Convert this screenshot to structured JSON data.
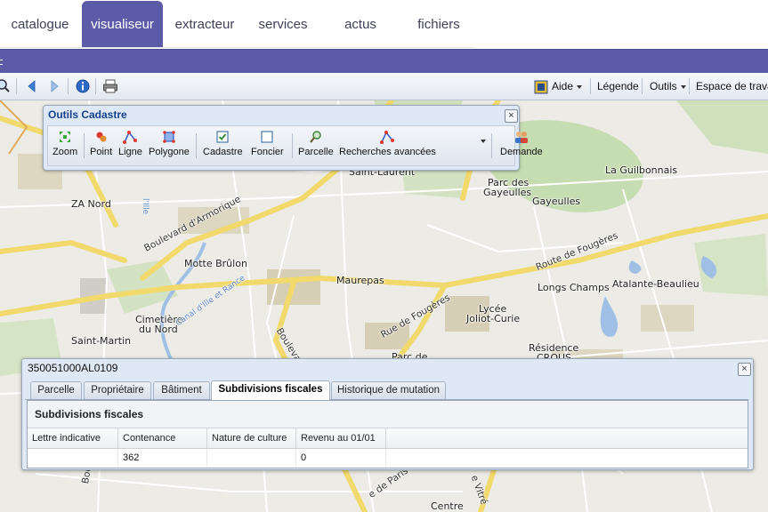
{
  "nav": {
    "tabs": [
      {
        "label": "catalogue"
      },
      {
        "label": "visualiseur"
      },
      {
        "label": "extracteur"
      },
      {
        "label": "services"
      },
      {
        "label": "actus"
      },
      {
        "label": "fichiers"
      }
    ],
    "active_index": 1
  },
  "toolbar": {
    "help_label": "Aide",
    "legend_label": "Légende",
    "tools_label": "Outils",
    "workspace_label": "Espace de travail"
  },
  "outils_cadastre": {
    "title": "Outils Cadastre",
    "tools": [
      {
        "label": "Zoom",
        "icon": "zoom-extent-icon"
      },
      {
        "label": "Point",
        "icon": "point-icon"
      },
      {
        "label": "Ligne",
        "icon": "line-icon"
      },
      {
        "label": "Polygone",
        "icon": "polygon-icon"
      },
      {
        "label": "Cadastre",
        "icon": "checkbox-icon"
      },
      {
        "label": "Foncier",
        "icon": "checkbox-empty-icon"
      },
      {
        "label": "Parcelle",
        "icon": "search-parcel-icon"
      },
      {
        "label": "Recherches avancées",
        "icon": "advanced-search-icon"
      },
      {
        "label": "Demande",
        "icon": "users-icon"
      }
    ]
  },
  "map": {
    "labels": {
      "saint_laurent": "Saint-Laurent",
      "la_guilbonnais": "La Guilbonnais",
      "parc_des_gayeulles_1": "Parc des",
      "parc_des_gayeulles_2": "Gayeulles",
      "gayeulles": "Gayeulles",
      "za_nord": "ZA Nord",
      "bd_armorique": "Boulevard d'Armorique",
      "motte_brulon": "Motte Brûlon",
      "route_fougeres": "Route de Fougères",
      "maurepas": "Maurepas",
      "longs_champs": "Longs Champs",
      "atalante": "Atalante-Beaulieu",
      "lycee_1": "Lycée",
      "lycee_2": "Joliot-Curie",
      "rue_fougeres": "Rue de Fougères",
      "cimetiere_1": "Cimetière",
      "cimetiere_2": "du Nord",
      "saint_martin": "Saint-Martin",
      "boulevard": "Boulevard",
      "residence_1": "Résidence",
      "residence_2": "CROUS",
      "parc_de": "Parc de",
      "rue_paris": "e de Paris",
      "centre": "Centre",
      "vitre": "e Vitré",
      "canal": "Canal d'Ille et Rance",
      "ille": "l'Ille"
    }
  },
  "parcel_window": {
    "title": "350051000AL0109",
    "tabs": [
      "Parcelle",
      "Propriétaire",
      "Bâtiment",
      "Subdivisions fiscales",
      "Historique de mutation"
    ],
    "active_tab": 3,
    "section_title": "Subdivisions fiscales",
    "columns": [
      "Lettre indicative",
      "Contenance",
      "Nature de culture",
      "Revenu au 01/01"
    ],
    "rows": [
      [
        "",
        "362",
        "",
        "0"
      ]
    ]
  }
}
